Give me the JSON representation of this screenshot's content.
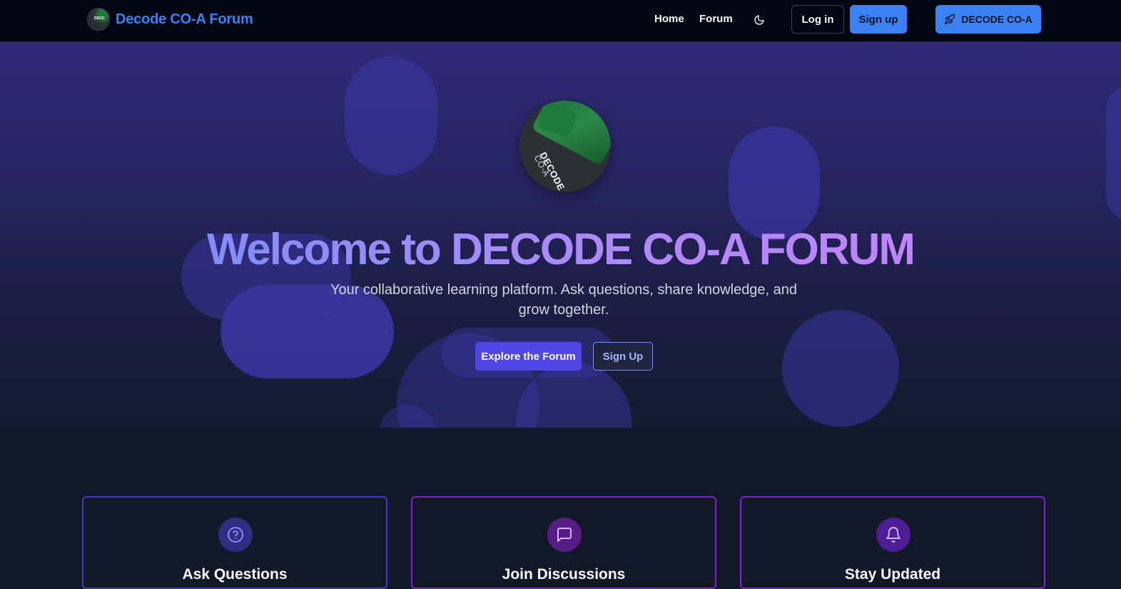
{
  "nav": {
    "brand": "Decode CO-A Forum",
    "links": {
      "home": "Home",
      "forum": "Forum"
    },
    "login": "Log in",
    "signup": "Sign up",
    "decode_button": "DECODE CO-A"
  },
  "hero": {
    "logo_text": "DECODE",
    "logo_text2": "CO-A",
    "title": "Welcome to DECODE CO-A FORUM",
    "subtitle": "Your collaborative learning platform. Ask questions, share knowledge, and grow together.",
    "explore_button": "Explore the Forum",
    "signup_button": "Sign Up"
  },
  "features": [
    {
      "title": "Ask Questions",
      "icon": "question-circle-icon"
    },
    {
      "title": "Join Discussions",
      "icon": "message-square-icon"
    },
    {
      "title": "Stay Updated",
      "icon": "bell-icon"
    }
  ],
  "colors": {
    "accent": "#3b82f6",
    "primary": "#4f46e5",
    "background": "#111827",
    "nav_background": "#030712"
  }
}
